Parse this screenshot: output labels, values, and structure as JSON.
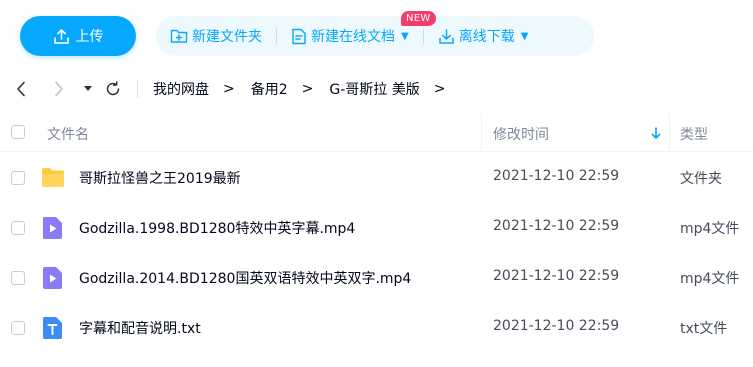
{
  "toolbar": {
    "upload_label": "上传",
    "new_folder_label": "新建文件夹",
    "new_online_doc_label": "新建在线文档",
    "new_badge": "NEW",
    "offline_download_label": "离线下载"
  },
  "nav": {
    "breadcrumbs": [
      "我的网盘",
      "备用2",
      "G-哥斯拉 美版"
    ],
    "separator": ">"
  },
  "table": {
    "headers": {
      "name": "文件名",
      "modified": "修改时间",
      "type": "类型"
    },
    "rows": [
      {
        "icon": "folder-icon",
        "name": "哥斯拉怪兽之王2019最新",
        "modified": "2021-12-10 22:59",
        "type": "文件夹"
      },
      {
        "icon": "video-file-icon",
        "name": "Godzilla.1998.BD1280特效中英字幕.mp4",
        "modified": "2021-12-10 22:59",
        "type": "mp4文件"
      },
      {
        "icon": "video-file-icon",
        "name": "Godzilla.2014.BD1280国英双语特效中英双字.mp4",
        "modified": "2021-12-10 22:59",
        "type": "mp4文件"
      },
      {
        "icon": "text-file-icon",
        "name": "字幕和配音说明.txt",
        "modified": "2021-12-10 22:59",
        "type": "txt文件"
      }
    ]
  },
  "colors": {
    "accent": "#06a7ff",
    "badge": "#f33d6a",
    "folder": "#ffc93d",
    "video": "#8b7cf6",
    "text_file": "#3a8cfb"
  }
}
